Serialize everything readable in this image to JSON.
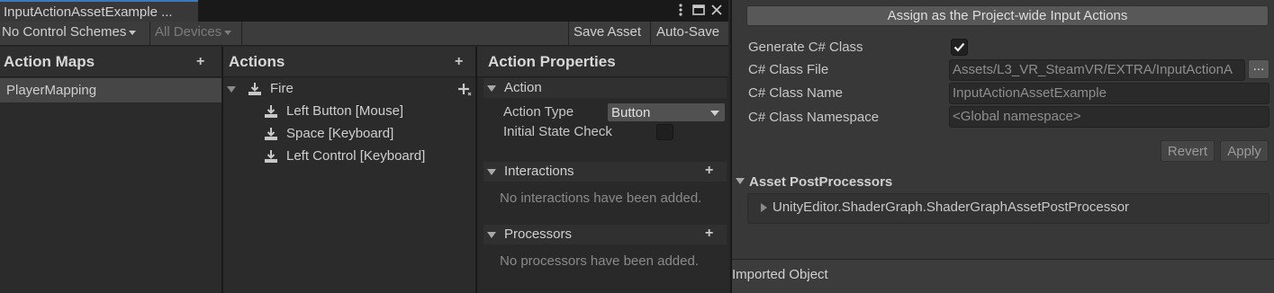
{
  "window": {
    "tab_title": "InputActionAssetExample ...",
    "icons": [
      "kebab-menu-icon",
      "maximize-icon",
      "close-icon"
    ]
  },
  "toolbar": {
    "control_schemes": "No Control Schemes",
    "devices": "All Devices",
    "save_asset": "Save Asset",
    "auto_save": "Auto-Save"
  },
  "action_maps": {
    "title": "Action Maps",
    "add": "+",
    "items": [
      {
        "label": "PlayerMapping",
        "selected": true
      }
    ]
  },
  "actions": {
    "title": "Actions",
    "add": "+",
    "items": [
      {
        "label": "Fire",
        "type": "action",
        "expanded": true
      },
      {
        "label": "Left Button [Mouse]",
        "type": "binding"
      },
      {
        "label": "Space [Keyboard]",
        "type": "binding"
      },
      {
        "label": "Left Control [Keyboard]",
        "type": "binding"
      }
    ]
  },
  "properties": {
    "title": "Action Properties",
    "action_section": "Action",
    "action_type_label": "Action Type",
    "action_type_value": "Button",
    "initial_state_label": "Initial State Check",
    "initial_state_checked": false,
    "interactions_title": "Interactions",
    "interactions_add": "+",
    "interactions_empty": "No interactions have been added.",
    "processors_title": "Processors",
    "processors_add": "+",
    "processors_empty": "No processors have been added."
  },
  "inspector": {
    "assign_button": "Assign as the Project-wide Input Actions",
    "generate_label": "Generate C# Class",
    "generate_checked": true,
    "class_file_label": "C# Class File",
    "class_file_value": "Assets/L3_VR_SteamVR/EXTRA/InputActionA",
    "browse_button": "...",
    "class_name_label": "C# Class Name",
    "class_name_value": "InputActionAssetExample",
    "namespace_label": "C# Class Namespace",
    "namespace_placeholder": "<Global namespace>",
    "revert": "Revert",
    "apply": "Apply",
    "postprocessors_title": "Asset PostProcessors",
    "postprocessor_item": "UnityEditor.ShaderGraph.ShaderGraphAssetPostProcessor",
    "imported_object": "Imported Object"
  },
  "colors": {
    "accent": "#3a79bb",
    "selected_row": "#464646",
    "panel_bg": "#282828",
    "inspector_bg": "#383838"
  }
}
